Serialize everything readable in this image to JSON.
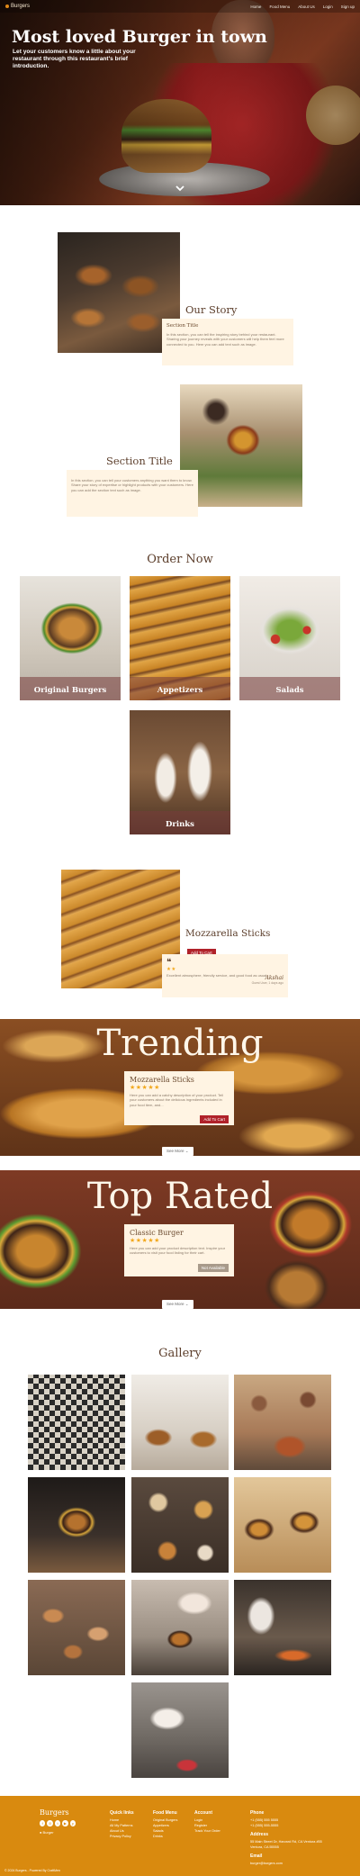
{
  "nav": {
    "brand": "Burgers",
    "links": [
      "Home",
      "Food Menu",
      "About Us",
      "Login",
      "Sign up"
    ]
  },
  "hero": {
    "title": "Most loved Burger in town",
    "subtitle": "Let your customers know a little about your restaurant through this restaurant's brief introduction."
  },
  "story": {
    "heading": "Our Story",
    "card_title": "Section Title",
    "card_text": "In this section, you can tell the inspiring story behind your restaurant. Sharing your journey reveals with your customers will help them feel more connected to you. Here you can add text such as image."
  },
  "section2": {
    "heading": "Section Title",
    "card_text": "In this section, you can tell your customers anything you want them to know. Share your story of expertise or highlight products with your customers. Here you can add the section text such as image."
  },
  "order": {
    "heading": "Order Now",
    "tiles": [
      "Original Burgers",
      "Appetizers",
      "Salads",
      "Drinks"
    ]
  },
  "product": {
    "name": "Mozzarella Sticks",
    "button": "Add To Cart",
    "stars": "★★",
    "review": "Excellent atmosphere, friendly service, and good food as usual",
    "reviewer_name": "Akshai",
    "reviewer_meta": "Guest User, 1 days ago"
  },
  "trending": {
    "title": "Trending",
    "card_title": "Mozzarella Sticks",
    "stars": "★★★★★",
    "card_text": "Here you can add a catchy description of your product. Tell your customers about the delicious ingredients included in your food item, and...",
    "button": "Add To Cart",
    "see_more": "See More"
  },
  "top_rated": {
    "title": "Top Rated",
    "card_title": "Classic Burger",
    "stars": "★★★★★",
    "card_text": "Here you can add your product description text. Inspire your customers to visit your food listing for their cart.",
    "button": "Not Available",
    "see_more": "See More"
  },
  "gallery": {
    "heading": "Gallery"
  },
  "footer": {
    "brand": "Burgers",
    "tagline": "Burger",
    "copyright": "© 2024 Burgers - Powered By CraftMen",
    "quick_links": {
      "title": "Quick links",
      "items": [
        "Home",
        "All My Patterns",
        "About Us",
        "Privacy Policy"
      ]
    },
    "food_menu": {
      "title": "Food Menu",
      "items": [
        "Original Burgers",
        "Appetizers",
        "Salads",
        "Drinks"
      ]
    },
    "account": {
      "title": "Account",
      "items": [
        "Login",
        "Register",
        "Track Your Order"
      ]
    },
    "phone": {
      "title": "Phone",
      "items": [
        "+1 (555) 555 5555",
        "+1 (555) 555-5555"
      ]
    },
    "address": {
      "title": "Address",
      "items": [
        "55 Main Street Dr, Harvard Rd, CA Ventura #55",
        "Ventura, CA 55555"
      ]
    },
    "email": {
      "title": "Email",
      "items": [
        "burger@burgers.com"
      ]
    }
  },
  "colors": {
    "accent": "#d98a0f",
    "heading_brown": "#5b3d2a",
    "card_bg": "#fff4e3",
    "button_red": "#b0222a"
  }
}
